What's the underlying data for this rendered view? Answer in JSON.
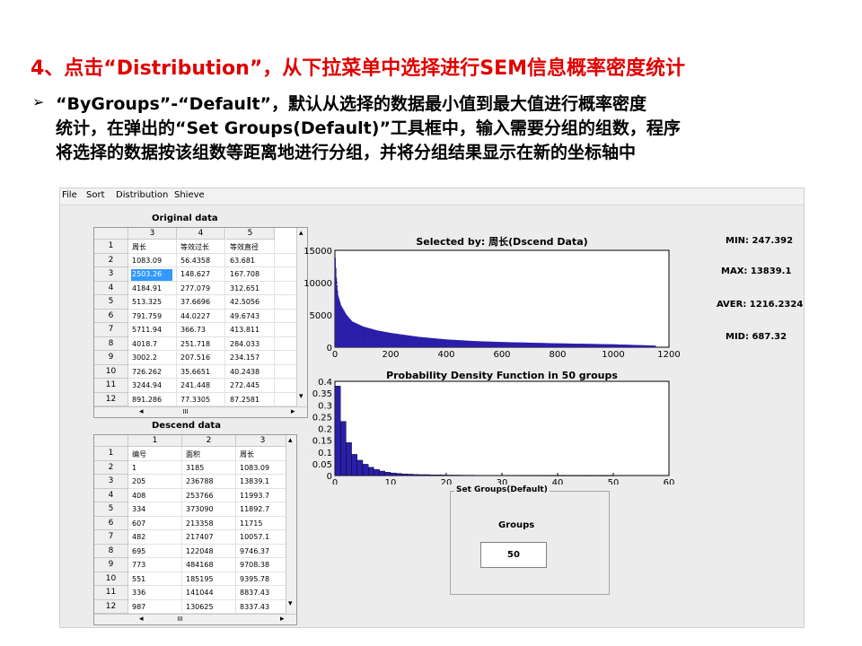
{
  "slide": {
    "title": "4、点击“Distribution”，从下拉菜单中选择进行SEM信息概率密度统计",
    "bullet": "➢",
    "lines": [
      "“ByGroups”-“Default”，默认从选择的数据最小值到最大值进行概率密度",
      "统计，在弹出的“Set Groups(Default)”工具框中，输入需要分组的组数，程序",
      "将选择的数据按该组数等距离地进行分组，并将分组结果显示在新的坐标轴中"
    ]
  },
  "menu": [
    "File",
    "Sort",
    "Distribution",
    "Shieve"
  ],
  "original_table": {
    "caption": "Original data",
    "columns": [
      "3",
      "4",
      "5"
    ],
    "rows": [
      [
        "1",
        "周长",
        "等效过长",
        "等效直径"
      ],
      [
        "2",
        "1083.09",
        "56.4358",
        "63.681"
      ],
      [
        "3",
        "2503.26",
        "148.627",
        "167.708"
      ],
      [
        "4",
        "4184.91",
        "277.079",
        "312.651"
      ],
      [
        "5",
        "513.325",
        "37.6696",
        "42.5056"
      ],
      [
        "6",
        "791.759",
        "44.0227",
        "49.6743"
      ],
      [
        "7",
        "5711.94",
        "366.73",
        "413.811"
      ],
      [
        "8",
        "4018.7",
        "251.718",
        "284.033"
      ],
      [
        "9",
        "3002.2",
        "207.516",
        "234.157"
      ],
      [
        "10",
        "726.262",
        "35.6651",
        "40.2438"
      ],
      [
        "11",
        "3244.94",
        "241.448",
        "272.445"
      ],
      [
        "12",
        "891.286",
        "77.3305",
        "87.2581"
      ]
    ],
    "scroll_grip": "III"
  },
  "descend_table": {
    "caption": "Descend data",
    "columns": [
      "1",
      "2",
      "3"
    ],
    "rows": [
      [
        "1",
        "编号",
        "面积",
        "周长"
      ],
      [
        "2",
        "1",
        "3185",
        "1083.09"
      ],
      [
        "3",
        "205",
        "236788",
        "13839.1"
      ],
      [
        "4",
        "408",
        "253766",
        "11993.7"
      ],
      [
        "5",
        "334",
        "373090",
        "11892.7"
      ],
      [
        "6",
        "607",
        "213358",
        "11715"
      ],
      [
        "7",
        "482",
        "217407",
        "10057.1"
      ],
      [
        "8",
        "695",
        "122048",
        "9746.37"
      ],
      [
        "9",
        "773",
        "484168",
        "9708.38"
      ],
      [
        "10",
        "551",
        "185195",
        "9395.78"
      ],
      [
        "11",
        "336",
        "141044",
        "8837.43"
      ],
      [
        "12",
        "987",
        "130625",
        "8337.43"
      ]
    ],
    "scroll_grip": "III"
  },
  "stats": {
    "min": "MIN:  247.392",
    "max": "MAX:   13839.1",
    "aver": "AVER:  1216.2324",
    "mid": "MID:   687.32"
  },
  "set_groups": {
    "title": "Set Groups(Default)",
    "label": "Groups",
    "value": "50"
  },
  "chart_data": [
    {
      "type": "area",
      "title": "Selected by: 周长(Dscend Data)",
      "xlabel": "",
      "ylabel": "",
      "xlim": [
        0,
        1200
      ],
      "ylim": [
        0,
        15000
      ],
      "xticks": [
        "0",
        "200",
        "400",
        "600",
        "800",
        "1000",
        "1200"
      ],
      "yticks": [
        "0",
        "5000",
        "10000",
        "15000"
      ],
      "n_points": 1150,
      "x": [
        0,
        5,
        10,
        20,
        40,
        60,
        100,
        150,
        200,
        300,
        400,
        500,
        600,
        800,
        1000,
        1150
      ],
      "y": [
        13839,
        10000,
        8000,
        6500,
        5000,
        4000,
        3200,
        2600,
        2200,
        1600,
        1200,
        950,
        800,
        600,
        450,
        250
      ],
      "fill": "#2a1fa8",
      "grid": false
    },
    {
      "type": "bar",
      "title": "Probability Density Function in 50 groups",
      "xlabel": "",
      "ylabel": "",
      "xlim": [
        0,
        60
      ],
      "ylim": [
        0,
        0.4
      ],
      "xticks": [
        "0",
        "10",
        "20",
        "30",
        "40",
        "50",
        "60"
      ],
      "yticks": [
        "0",
        "0.05",
        "0.1",
        "0.15",
        "0.2",
        "0.25",
        "0.3",
        "0.35",
        "0.4"
      ],
      "x": [
        1,
        2,
        3,
        4,
        5,
        6,
        7,
        8,
        9,
        10,
        11,
        12,
        13,
        14,
        15,
        16,
        17,
        18,
        19,
        20,
        21,
        22,
        23,
        24,
        25,
        26,
        27,
        28,
        29,
        30,
        31,
        32,
        33,
        34,
        35,
        36,
        37,
        38,
        39,
        40,
        41,
        42,
        43,
        44,
        45,
        46,
        47,
        48,
        49,
        50
      ],
      "values": [
        0.38,
        0.23,
        0.14,
        0.09,
        0.065,
        0.048,
        0.035,
        0.026,
        0.019,
        0.014,
        0.011,
        0.009,
        0.007,
        0.006,
        0.005,
        0.004,
        0.004,
        0.003,
        0.003,
        0.0025,
        0.002,
        0.002,
        0.0018,
        0.0015,
        0.0015,
        0.0012,
        0.001,
        0.001,
        0.001,
        0.0008,
        0.0008,
        0.0006,
        0.0006,
        0.0005,
        0.0005,
        0.0004,
        0.0004,
        0.0003,
        0.0003,
        0.0003,
        0.0002,
        0.0002,
        0.0002,
        0.0002,
        0.0001,
        0.0001,
        0.0001,
        0.0001,
        0.0001,
        0.0001
      ],
      "fill": "#2a1fa8",
      "grid": false
    }
  ]
}
